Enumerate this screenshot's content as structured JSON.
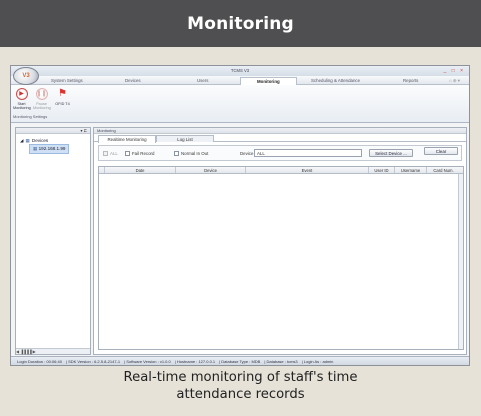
{
  "header": {
    "title": "Monitoring"
  },
  "caption": {
    "line1": "Real-time monitoring of staff's time",
    "line2": "attendance records"
  },
  "colors": {
    "header_bg": "#4f4f51",
    "page_bg": "#e6e2d8",
    "accent_red": "#cc3333"
  },
  "window": {
    "title": "TCMS V3",
    "logo_text": "V3",
    "controls": "_ □ ×"
  },
  "menu": {
    "items": [
      "System Settings",
      "Devices",
      "Users",
      "Monitoring",
      "Scheduling & Attendance",
      "Reports"
    ],
    "active": "Monitoring",
    "right_icons": "⌂ ⊕ ▾"
  },
  "ribbon": {
    "buttons": [
      {
        "label": "Start Monitoring",
        "icon": "play-icon",
        "enabled": true
      },
      {
        "label": "Pause Monitoring",
        "icon": "pause-icon",
        "enabled": false
      },
      {
        "label": "OFID T4",
        "icon": "flag-icon",
        "enabled": true
      }
    ],
    "group_label": "Monitoring Settings"
  },
  "left_panel": {
    "pin": "▾ ⊏",
    "tree_root": "Devices",
    "tree_child": "192.168.1.99",
    "scroll": "◀ ▐▐▐▐ ▶"
  },
  "monitor": {
    "panel_title": "Monitoring",
    "tabs": [
      "Realtime Monitoring",
      "Log List"
    ],
    "active_tab": "Realtime Monitoring",
    "all_label": "ALL",
    "fail_record_label": "Fail Record",
    "normal_inout_label": "Normal In Out",
    "device_label": "Device",
    "device_value": "ALL",
    "select_device_button": "Select Device ...",
    "clear_button": "Clear",
    "columns": [
      "Date",
      "Device",
      "Event",
      "User ID",
      "Username",
      "Card Num."
    ]
  },
  "status": {
    "items": [
      "Login Duration : 00:06:40",
      "SDK Version : 6.2.5.8-2147-1",
      "Software Version : v1.0.0",
      "Hostname : 127.0.0.1",
      "Database Type : MDB",
      "Database : tcms3",
      "Login As : admin"
    ]
  }
}
